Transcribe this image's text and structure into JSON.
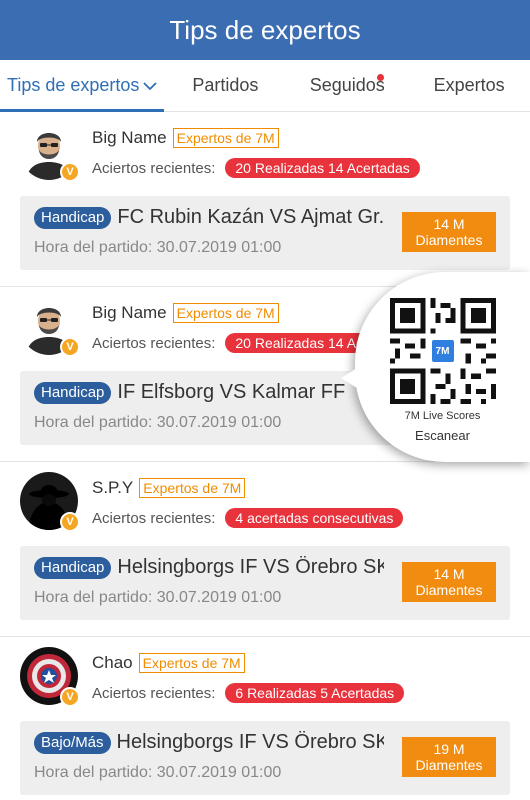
{
  "header": {
    "title": "Tips de expertos"
  },
  "tabs": [
    {
      "label": "Tips de expertos",
      "active": true,
      "dropdown": true
    },
    {
      "label": "Partidos"
    },
    {
      "label": "Seguidos",
      "notification_dot": true
    },
    {
      "label": "Expertos"
    }
  ],
  "common": {
    "stats_label": "Aciertos recientes:",
    "time_prefix": "Hora del partido:",
    "expert_badge_icon": "verified-v-icon"
  },
  "posts": [
    {
      "name": "Big  Name",
      "tag": "Expertos de 7M",
      "stats": "20 Realizadas 14 Acertadas",
      "avatar": "bearded-man-avatar",
      "match": {
        "type": "Handicap",
        "title": "FC Rubin Kazán  VS  Ajmat Gr...",
        "time": "Hora del partido: 30.07.2019 01:00",
        "price_line1": "14 M",
        "price_line2": "Diamentes"
      }
    },
    {
      "name": "Big  Name",
      "tag": "Expertos de 7M",
      "stats": "20 Realizadas 14 Acertadas",
      "avatar": "bearded-man-avatar",
      "match": {
        "type": "Handicap",
        "title": "IF Elfsborg  VS  Kalmar FF",
        "time": "Hora del partido: 30.07.2019 01:00",
        "price_line1": "",
        "price_line2": ""
      }
    },
    {
      "name": "S.P.Y",
      "tag": "Expertos de 7M",
      "stats": "4 acertadas consecutivas",
      "avatar": "spy-silhouette-avatar",
      "match": {
        "type": "Handicap",
        "title": "Helsingborgs IF  VS  Örebro SK",
        "time": "Hora del partido: 30.07.2019 01:00",
        "price_line1": "14 M",
        "price_line2": "Diamentes"
      }
    },
    {
      "name": "Chao",
      "tag": "Expertos de 7M",
      "stats": "6 Realizadas 5 Acertadas",
      "avatar": "shield-avatar",
      "match": {
        "type": "Bajo/Más",
        "title": "Helsingborgs IF  VS  Örebro SK",
        "time": "Hora del partido: 30.07.2019 01:00",
        "price_line1": "19 M",
        "price_line2": "Diamentes"
      }
    }
  ],
  "qr_popup": {
    "logo": "7M",
    "caption": "7M Live Scores",
    "action": "Escanear"
  },
  "colors": {
    "header": "#3b6db2",
    "active_tab": "#2f6fb6",
    "tag_orange": "#f08c00",
    "stats_red": "#e8323c",
    "pill_blue": "#2c5d9c",
    "price_orange": "#f28c10"
  }
}
